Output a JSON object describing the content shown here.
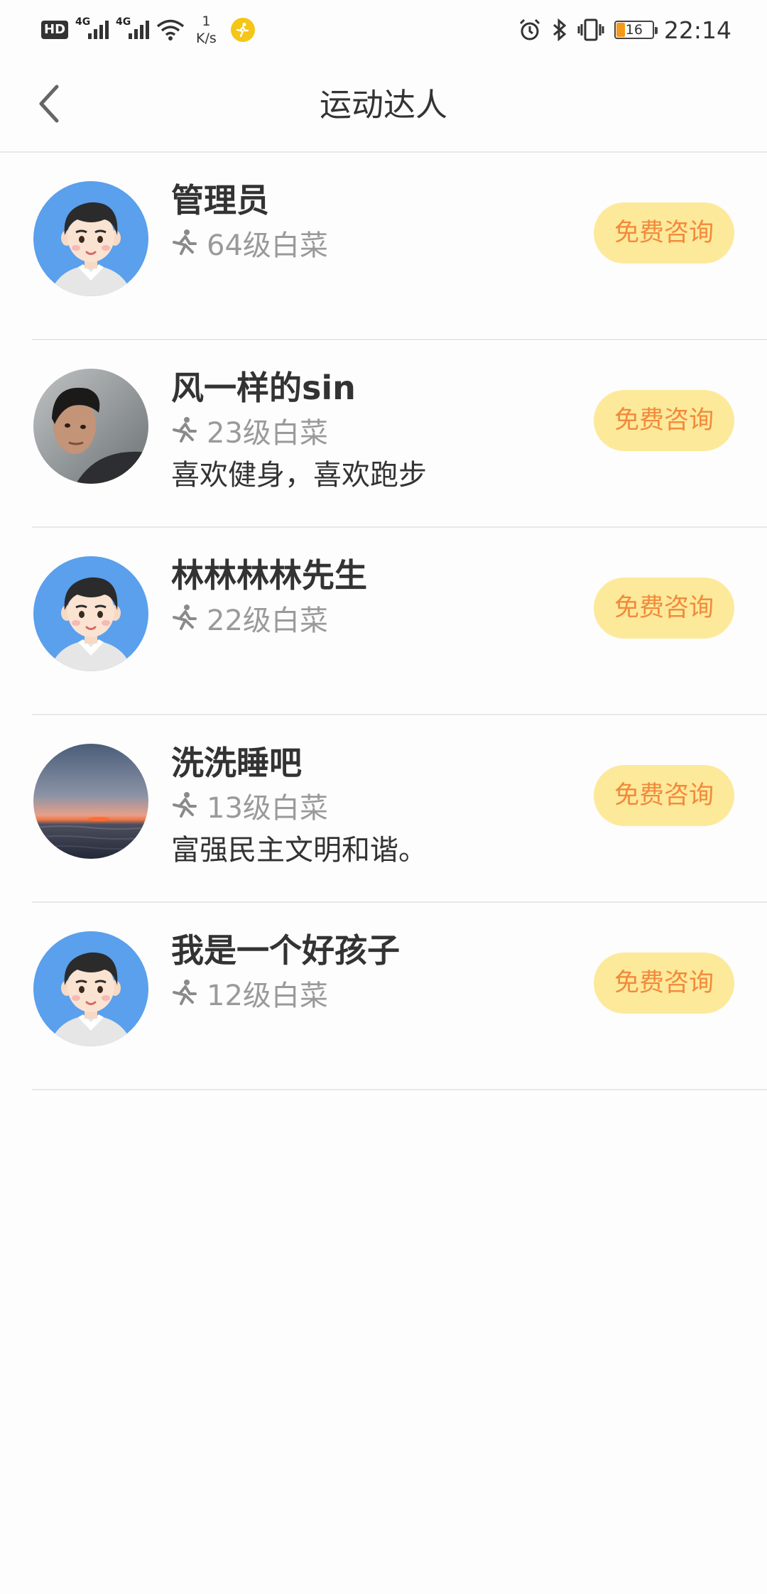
{
  "status_bar": {
    "hd": "HD",
    "net1": "4G",
    "net2": "4G",
    "speed_value": "1",
    "speed_unit": "K/s",
    "battery": "16",
    "time": "22:14"
  },
  "header": {
    "title": "运动达人"
  },
  "users": [
    {
      "name": "管理员",
      "level": "64级白菜",
      "bio": "",
      "button": "免费咨询",
      "avatar": "cartoon-boy"
    },
    {
      "name": "风一样的sin",
      "level": "23级白菜",
      "bio": "喜欢健身，喜欢跑步",
      "button": "免费咨询",
      "avatar": "photo-man"
    },
    {
      "name": "林林林林先生",
      "level": "22级白菜",
      "bio": "",
      "button": "免费咨询",
      "avatar": "cartoon-boy"
    },
    {
      "name": "洗洗睡吧",
      "level": "13级白菜",
      "bio": "富强民主文明和谐。",
      "button": "免费咨询",
      "avatar": "photo-sunset"
    },
    {
      "name": "我是一个好孩子",
      "level": "12级白菜",
      "bio": "",
      "button": "免费咨询",
      "avatar": "cartoon-boy"
    }
  ],
  "colors": {
    "button_bg": "#fde99a",
    "button_text": "#f28a3c",
    "avatar_bg": "#5aa0ec",
    "level_text": "#9a9a9a"
  }
}
